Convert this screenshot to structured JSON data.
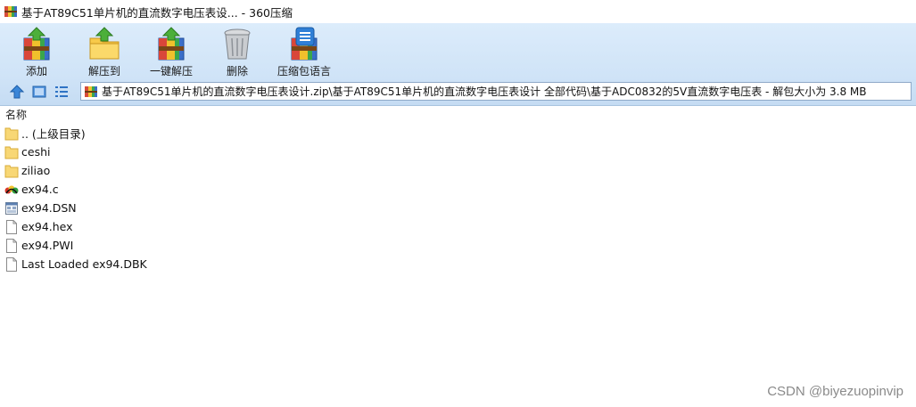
{
  "window": {
    "title": "基于AT89C51单片机的直流数字电压表设... - 360压缩"
  },
  "toolbar": {
    "buttons": [
      {
        "label": "添加",
        "icon": "add-archive-icon"
      },
      {
        "label": "解压到",
        "icon": "extract-to-icon"
      },
      {
        "label": "一键解压",
        "icon": "one-click-extract-icon"
      },
      {
        "label": "删除",
        "icon": "delete-bin-icon"
      },
      {
        "label": "压缩包语言",
        "icon": "archive-language-icon"
      }
    ]
  },
  "address": {
    "path": "基于AT89C51单片机的直流数字电压表设计.zip\\基于AT89C51单片机的直流数字电压表设计 全部代码\\基于ADC0832的5V直流数字电压表 - 解包大小为 3.8 MB"
  },
  "list": {
    "header_name": "名称",
    "files": [
      {
        "name": ".. (上级目录)",
        "type": "folder"
      },
      {
        "name": "ceshi",
        "type": "folder"
      },
      {
        "name": "ziliao",
        "type": "folder"
      },
      {
        "name": "ex94.c",
        "type": "c-source"
      },
      {
        "name": "ex94.DSN",
        "type": "dsn"
      },
      {
        "name": "ex94.hex",
        "type": "file"
      },
      {
        "name": "ex94.PWI",
        "type": "file"
      },
      {
        "name": "Last Loaded ex94.DBK",
        "type": "file"
      }
    ]
  },
  "watermark": "CSDN @biyezuopinvip"
}
